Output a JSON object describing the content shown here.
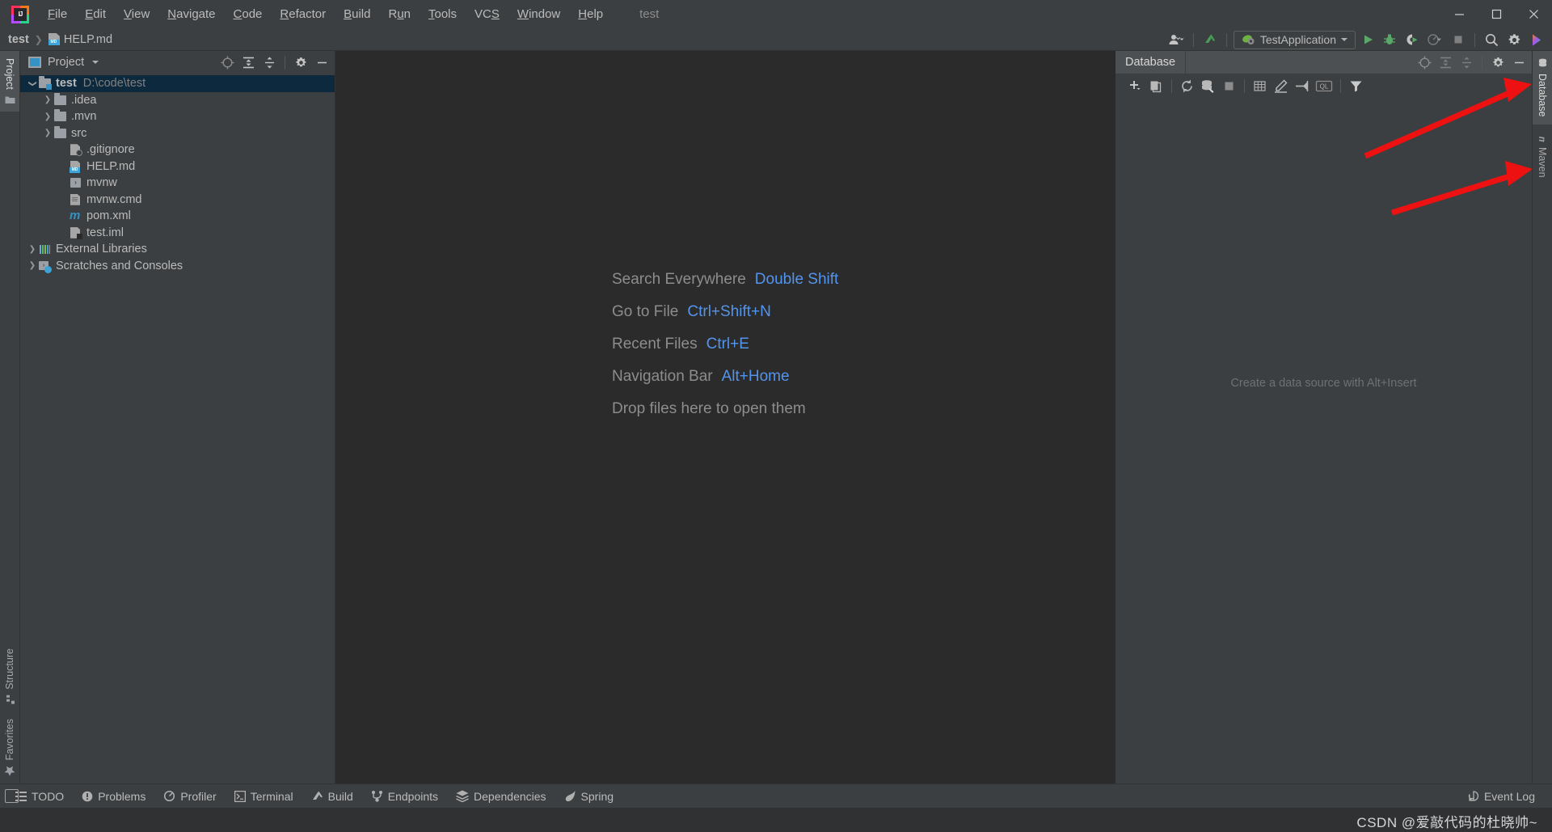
{
  "window": {
    "title": "test",
    "controls": {
      "minimize": "—",
      "maximize": "❐",
      "close": "✕"
    }
  },
  "menubar": {
    "items": [
      {
        "label": "File",
        "mnemonic": "F"
      },
      {
        "label": "Edit",
        "mnemonic": "E"
      },
      {
        "label": "View",
        "mnemonic": "V"
      },
      {
        "label": "Navigate",
        "mnemonic": "N"
      },
      {
        "label": "Code",
        "mnemonic": "C"
      },
      {
        "label": "Refactor",
        "mnemonic": "R"
      },
      {
        "label": "Build",
        "mnemonic": "B"
      },
      {
        "label": "Run",
        "mnemonic": "u"
      },
      {
        "label": "Tools",
        "mnemonic": "T"
      },
      {
        "label": "VCS",
        "mnemonic": "S"
      },
      {
        "label": "Window",
        "mnemonic": "W"
      },
      {
        "label": "Help",
        "mnemonic": "H"
      }
    ]
  },
  "navbar": {
    "breadcrumb": [
      {
        "label": "test",
        "icon": ""
      },
      {
        "label": "HELP.md",
        "icon": "markdown-icon"
      }
    ],
    "run_configuration": "TestApplication",
    "icons": [
      "account-icon",
      "updates-icon",
      "run-icon",
      "debug-icon",
      "run-coverage-icon",
      "profiler-icon",
      "stop-icon",
      "search-icon",
      "settings-icon",
      "toolbox-icon"
    ]
  },
  "left_stripe": {
    "top": [
      {
        "label": "Project",
        "icon": "project-icon",
        "active": true
      }
    ],
    "bottom": [
      {
        "label": "Structure",
        "icon": "structure-icon",
        "active": false
      },
      {
        "label": "Favorites",
        "icon": "star-icon",
        "active": false
      }
    ]
  },
  "right_stripe": {
    "tabs": [
      {
        "label": "Database",
        "icon": "database-icon",
        "active": true
      },
      {
        "label": "Maven",
        "icon": "maven-icon",
        "active": false
      }
    ]
  },
  "project_panel": {
    "title": "Project",
    "tools": [
      "locate-icon",
      "expand-all-icon",
      "collapse-all-icon",
      "settings-icon",
      "hide-icon"
    ],
    "tree": [
      {
        "label": "test",
        "path": "D:\\code\\test",
        "icon": "module-icon",
        "indent": 0,
        "arrow": "down",
        "selected": true,
        "bold": true
      },
      {
        "label": ".idea",
        "path": "",
        "icon": "folder-icon",
        "indent": 1,
        "arrow": "right",
        "selected": false,
        "bold": false
      },
      {
        "label": ".mvn",
        "path": "",
        "icon": "folder-icon",
        "indent": 1,
        "arrow": "right",
        "selected": false,
        "bold": false
      },
      {
        "label": "src",
        "path": "",
        "icon": "folder-icon",
        "indent": 1,
        "arrow": "right",
        "selected": false,
        "bold": false
      },
      {
        "label": ".gitignore",
        "path": "",
        "icon": "gitignore-icon",
        "indent": 2,
        "arrow": "none",
        "selected": false,
        "bold": false
      },
      {
        "label": "HELP.md",
        "path": "",
        "icon": "markdown-icon",
        "indent": 2,
        "arrow": "none",
        "selected": false,
        "bold": false
      },
      {
        "label": "mvnw",
        "path": "",
        "icon": "shell-icon",
        "indent": 2,
        "arrow": "none",
        "selected": false,
        "bold": false
      },
      {
        "label": "mvnw.cmd",
        "path": "",
        "icon": "textfile-icon",
        "indent": 2,
        "arrow": "none",
        "selected": false,
        "bold": false
      },
      {
        "label": "pom.xml",
        "path": "",
        "icon": "maven-icon",
        "indent": 2,
        "arrow": "none",
        "selected": false,
        "bold": false
      },
      {
        "label": "test.iml",
        "path": "",
        "icon": "iml-icon",
        "indent": 2,
        "arrow": "none",
        "selected": false,
        "bold": false
      },
      {
        "label": "External Libraries",
        "path": "",
        "icon": "libraries-icon",
        "indent": 0,
        "arrow": "right",
        "selected": false,
        "bold": false
      },
      {
        "label": "Scratches and Consoles",
        "path": "",
        "icon": "scratches-icon",
        "indent": 0,
        "arrow": "right",
        "selected": false,
        "bold": false
      }
    ]
  },
  "editor": {
    "hints": [
      {
        "label": "Search Everywhere",
        "key": "Double Shift"
      },
      {
        "label": "Go to File",
        "key": "Ctrl+Shift+N"
      },
      {
        "label": "Recent Files",
        "key": "Ctrl+E"
      },
      {
        "label": "Navigation Bar",
        "key": "Alt+Home"
      },
      {
        "label": "Drop files here to open them",
        "key": ""
      }
    ]
  },
  "database_panel": {
    "tab_label": "Database",
    "empty_message": "Create a data source with Alt+Insert",
    "header_tools": [
      "locate-icon",
      "expand-all-icon",
      "collapse-all-icon",
      "settings-icon",
      "hide-icon"
    ],
    "toolbar": [
      "add-icon",
      "duplicate-icon",
      "refresh-icon",
      "db-tools-icon",
      "stop-icon",
      "table-icon",
      "edit-icon",
      "jump-to-icon",
      "ql-console-icon",
      "filter-icon"
    ]
  },
  "statusbar": {
    "items": [
      {
        "label": "TODO",
        "icon": "todo-icon"
      },
      {
        "label": "Problems",
        "icon": "problems-icon"
      },
      {
        "label": "Profiler",
        "icon": "profiler-icon"
      },
      {
        "label": "Terminal",
        "icon": "terminal-icon"
      },
      {
        "label": "Build",
        "icon": "build-icon"
      },
      {
        "label": "Endpoints",
        "icon": "endpoints-icon"
      },
      {
        "label": "Dependencies",
        "icon": "dependencies-icon"
      },
      {
        "label": "Spring",
        "icon": "spring-icon"
      }
    ],
    "event_log": {
      "label": "Event Log",
      "icon": "event-log-icon"
    }
  },
  "watermark": "CSDN @爱敲代码的杜晓帅~",
  "colors": {
    "background": "#3c3f41",
    "editor_background": "#2b2b2b",
    "selection": "#0d293e",
    "accent_blue": "#5394ec",
    "text": "#bbbbbb",
    "dim_text": "#808080",
    "arrow_red": "#ee1111",
    "run_green": "#499c54"
  }
}
